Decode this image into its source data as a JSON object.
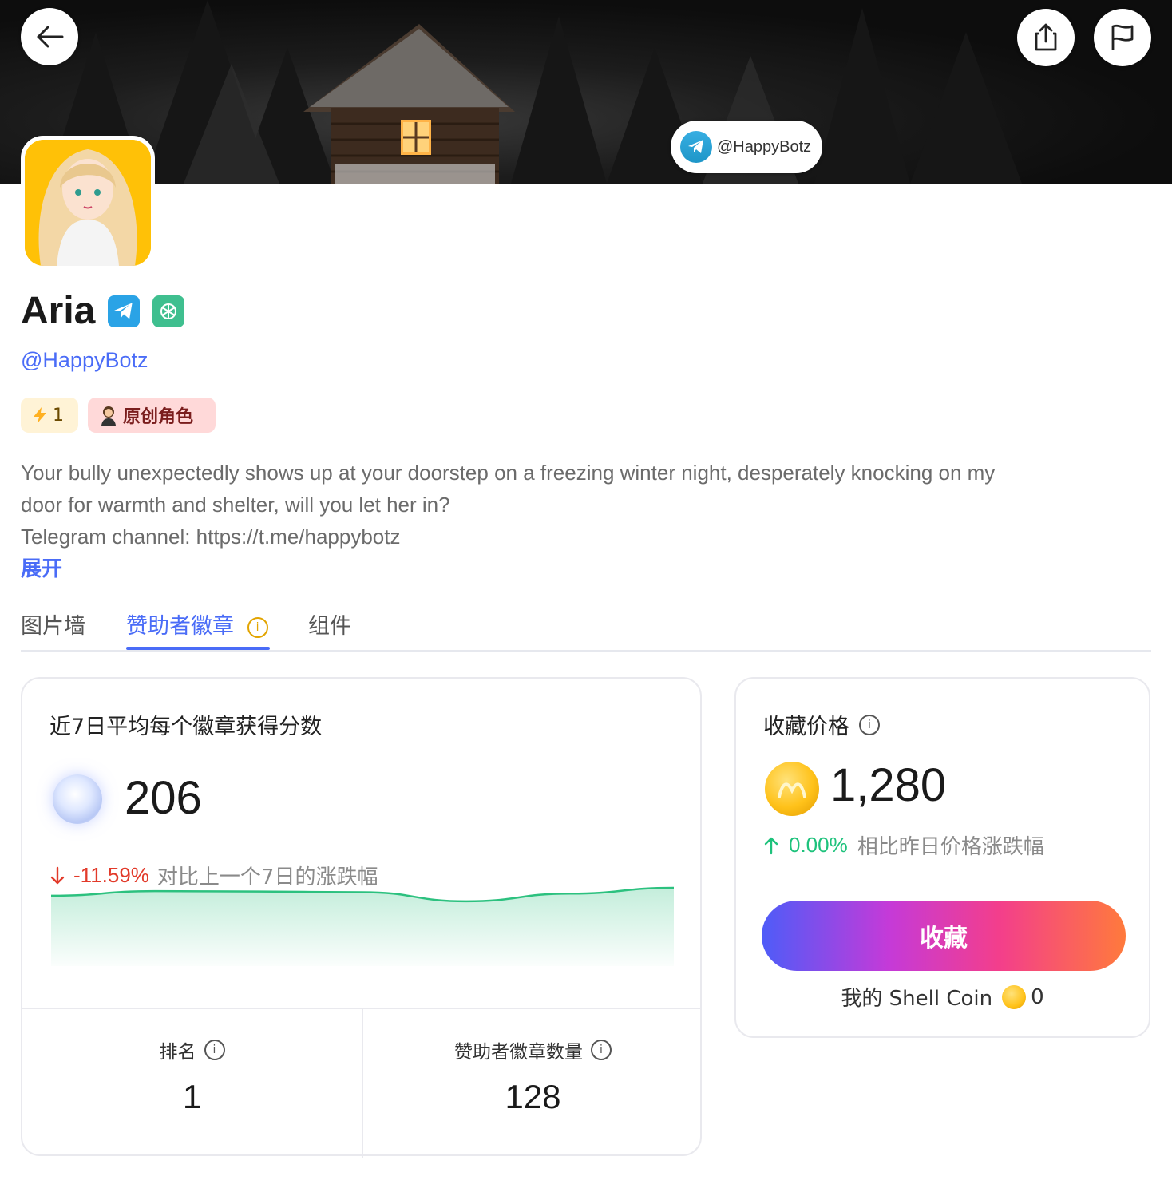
{
  "banner": {
    "telegram_handle": "@HappyBotz"
  },
  "profile": {
    "name": "Aria",
    "handle": "@HappyBotz",
    "badges": [
      "telegram-icon",
      "openai-icon"
    ],
    "energy_count": "1",
    "tag_label": "原创角色",
    "description_lines": [
      "Your bully unexpectedly shows up at your doorstep on a freezing winter night, desperately knocking on my",
      "door for warmth and shelter, will you let her in?",
      "Telegram channel: https://t.me/happybotz"
    ],
    "expand_label": "展开"
  },
  "tabs": [
    {
      "label": "图片墙",
      "active": false
    },
    {
      "label": "赞助者徽章",
      "active": true
    },
    {
      "label": "组件",
      "active": false
    }
  ],
  "score_card": {
    "title": "近7日平均每个徽章获得分数",
    "value": "206",
    "change": "-11.59%",
    "change_desc": "对比上一个7日的涨跌幅",
    "rank_label": "排名",
    "rank_value": "1",
    "count_label": "赞助者徽章数量",
    "count_value": "128"
  },
  "chart_data": {
    "type": "area",
    "x": [
      0,
      1,
      2,
      3,
      4,
      5,
      6
    ],
    "values": [
      0.62,
      0.84,
      0.82,
      0.79,
      0.35,
      0.72,
      1.0
    ],
    "color": "#2cc17f",
    "title": "",
    "xlabel": "",
    "ylabel": ""
  },
  "price_card": {
    "title": "收藏价格",
    "value": "1,280",
    "change": "0.00%",
    "change_desc": "相比昨日价格涨跌幅",
    "button_label": "收藏",
    "mycoin_label": "我的 Shell Coin",
    "mycoin_value": "0"
  },
  "colors": {
    "accent": "#4a6cf7",
    "down": "#e23a2a",
    "up": "#1ec27c"
  }
}
